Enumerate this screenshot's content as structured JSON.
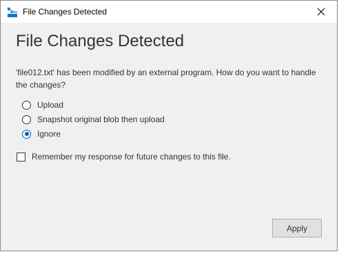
{
  "window": {
    "title": "File Changes Detected",
    "app_icon": "storage-explorer-icon",
    "close_icon": "close-icon"
  },
  "dialog": {
    "heading": "File Changes Detected",
    "message": "'file012.txt' has been modified by an external program. How do you want to handle the changes?",
    "options": [
      {
        "label": "Upload",
        "checked": false
      },
      {
        "label": "Snapshot original blob then upload",
        "checked": false
      },
      {
        "label": "Ignore",
        "checked": true
      }
    ],
    "remember_label": "Remember my response for future changes to this file.",
    "remember_checked": false,
    "apply_label": "Apply"
  },
  "colors": {
    "accent": "#005fb8",
    "background": "#f0f0f0",
    "titlebar": "#ffffff"
  }
}
